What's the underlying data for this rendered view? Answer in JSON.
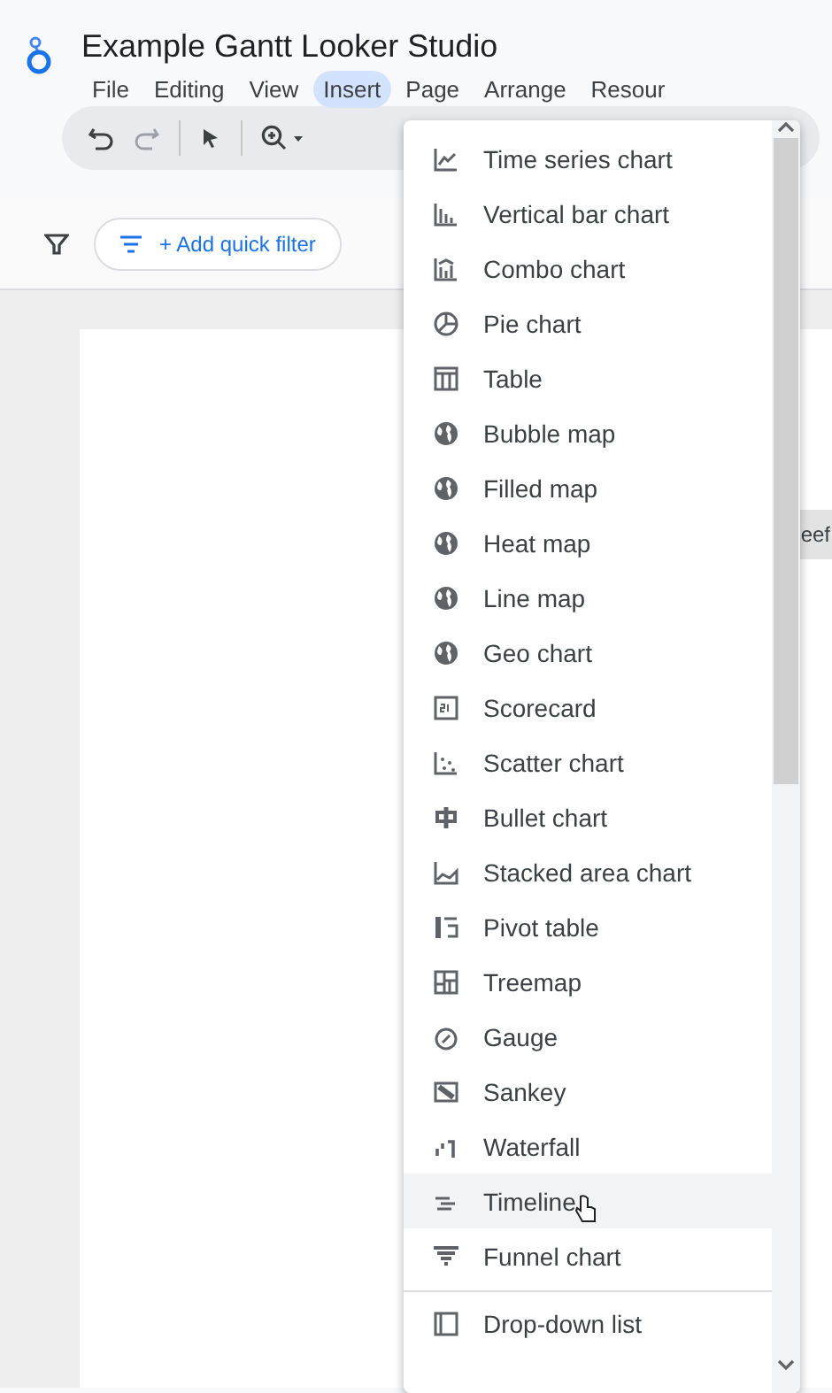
{
  "app": {
    "title": "Example Gantt Looker Studio"
  },
  "menu_bar": [
    {
      "label": "File",
      "selected": false
    },
    {
      "label": "Editing",
      "selected": false
    },
    {
      "label": "View",
      "selected": false
    },
    {
      "label": "Insert",
      "selected": true
    },
    {
      "label": "Page",
      "selected": false
    },
    {
      "label": "Arrange",
      "selected": false
    },
    {
      "label": "Resour",
      "selected": false
    }
  ],
  "filter_bar": {
    "add_filter": "+ Add quick filter"
  },
  "canvas": {
    "chip_text": "eef"
  },
  "insert_menu": {
    "items": [
      {
        "label": "Time series chart",
        "hovered": false
      },
      {
        "label": "Vertical bar chart",
        "hovered": false
      },
      {
        "label": "Combo chart",
        "hovered": false
      },
      {
        "label": "Pie chart",
        "hovered": false
      },
      {
        "label": "Table",
        "hovered": false
      },
      {
        "label": "Bubble map",
        "hovered": false
      },
      {
        "label": "Filled map",
        "hovered": false
      },
      {
        "label": "Heat map",
        "hovered": false
      },
      {
        "label": "Line map",
        "hovered": false
      },
      {
        "label": "Geo chart",
        "hovered": false
      },
      {
        "label": "Scorecard",
        "hovered": false
      },
      {
        "label": "Scatter chart",
        "hovered": false
      },
      {
        "label": "Bullet chart",
        "hovered": false
      },
      {
        "label": "Stacked area chart",
        "hovered": false
      },
      {
        "label": "Pivot table",
        "hovered": false
      },
      {
        "label": "Treemap",
        "hovered": false
      },
      {
        "label": "Gauge",
        "hovered": false
      },
      {
        "label": "Sankey",
        "hovered": false
      },
      {
        "label": "Waterfall",
        "hovered": false
      },
      {
        "label": "Timeline",
        "hovered": true
      },
      {
        "label": "Funnel chart",
        "hovered": false
      },
      {
        "label": "Drop-down list",
        "hovered": false
      }
    ]
  }
}
